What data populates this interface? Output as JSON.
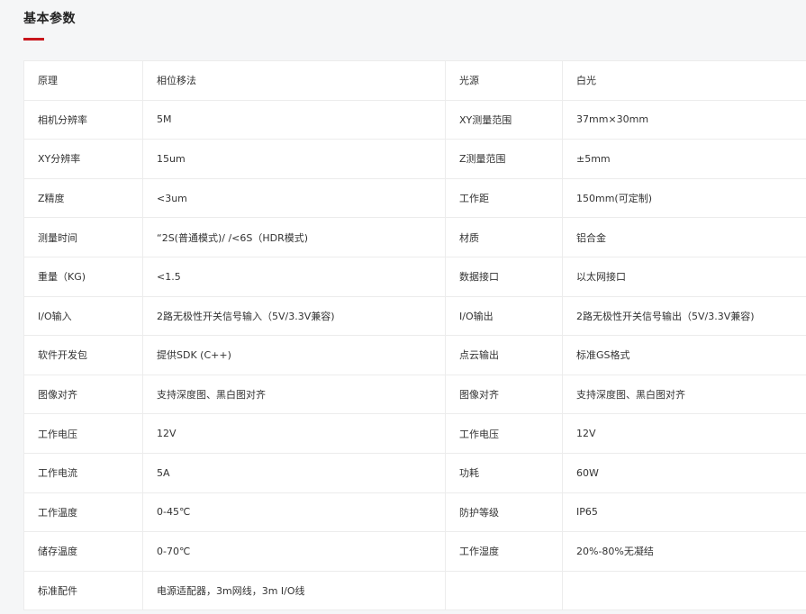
{
  "section": {
    "title": "基本参数",
    "accent_color": "#c8161d"
  },
  "rows": [
    [
      "原理",
      "相位移法",
      "光源",
      "白光"
    ],
    [
      "相机分辨率",
      "5M",
      "XY测量范围",
      "37mm×30mm"
    ],
    [
      "XY分辨率",
      "15um",
      "Z测量范围",
      "±5mm"
    ],
    [
      "Z精度",
      "<3um",
      "工作距",
      "150mm(可定制)"
    ],
    [
      "测量时间",
      "“2S(普通模式)/ /<6S（HDR模式)",
      "材质",
      "铝合金"
    ],
    [
      "重量（KG)",
      "<1.5",
      "数据接口",
      "以太网接口"
    ],
    [
      "I/O输入",
      "2路无极性开关信号输入（5V/3.3V兼容)",
      "I/O输出",
      "2路无极性开关信号输出（5V/3.3V兼容)"
    ],
    [
      "软件开发包",
      "提供SDK (C++)",
      "点云输出",
      "标准GS格式"
    ],
    [
      "图像对齐",
      "支持深度图、黑白图对齐",
      "图像对齐",
      "支持深度图、黑白图对齐"
    ],
    [
      "工作电压",
      "12V",
      "工作电压",
      "12V"
    ],
    [
      "工作电流",
      "5A",
      "功耗",
      "60W"
    ],
    [
      "工作温度",
      "0-45℃",
      "防护等级",
      "IP65"
    ],
    [
      "储存温度",
      "0-70℃",
      "工作湿度",
      "20%-80%无凝结"
    ],
    [
      "标准配件",
      "电源适配器，3m网线，3m I/O线",
      "",
      ""
    ]
  ]
}
